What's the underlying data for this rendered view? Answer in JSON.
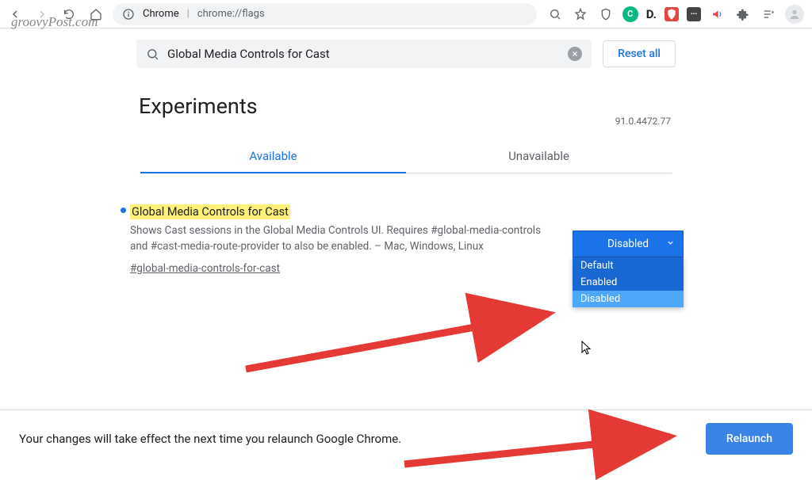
{
  "watermark": "groovyPost.com",
  "browser": {
    "site_label": "Chrome",
    "url": "chrome://flags",
    "green_badge": "C",
    "d_label": "D."
  },
  "search": {
    "value": "Global Media Controls for Cast"
  },
  "reset_label": "Reset all",
  "heading": "Experiments",
  "version": "91.0.4472.77",
  "tabs": {
    "available": "Available",
    "unavailable": "Unavailable"
  },
  "flag": {
    "title": "Global Media Controls for Cast",
    "description": "Shows Cast sessions in the Global Media Controls UI. Requires #global-media-controls and #cast-media-route-provider to also be enabled. – Mac, Windows, Linux",
    "link": "#global-media-controls-for-cast"
  },
  "dropdown": {
    "selected": "Disabled",
    "options": [
      "Default",
      "Enabled",
      "Disabled"
    ]
  },
  "bottom": {
    "message": "Your changes will take effect the next time you relaunch Google Chrome.",
    "button": "Relaunch"
  }
}
